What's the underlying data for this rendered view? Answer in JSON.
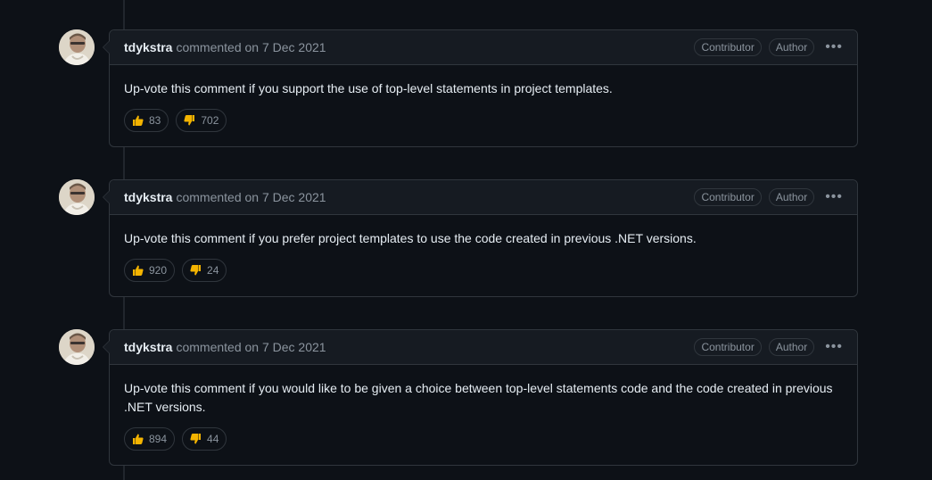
{
  "colors": {
    "background": "#0d1117",
    "header_bg": "#161b22",
    "border": "#30363d",
    "muted_text": "#8b949e",
    "text": "#e6edf3",
    "emoji_yellow": "#f4b400"
  },
  "comments": [
    {
      "author": "tdykstra",
      "meta": "commented on 7 Dec 2021",
      "labels": [
        "Contributor",
        "Author"
      ],
      "more_icon": "kebab-horizontal-icon",
      "body": "Up-vote this comment if you support the use of top-level statements in project templates.",
      "reactions": [
        {
          "icon": "thumbs-up-icon",
          "count": "83"
        },
        {
          "icon": "thumbs-down-icon",
          "count": "702"
        }
      ]
    },
    {
      "author": "tdykstra",
      "meta": "commented on 7 Dec 2021",
      "labels": [
        "Contributor",
        "Author"
      ],
      "more_icon": "kebab-horizontal-icon",
      "body": "Up-vote this comment if you prefer project templates to use the code created in previous .NET versions.",
      "reactions": [
        {
          "icon": "thumbs-up-icon",
          "count": "920"
        },
        {
          "icon": "thumbs-down-icon",
          "count": "24"
        }
      ]
    },
    {
      "author": "tdykstra",
      "meta": "commented on 7 Dec 2021",
      "labels": [
        "Contributor",
        "Author"
      ],
      "more_icon": "kebab-horizontal-icon",
      "body": "Up-vote this comment if you would like to be given a choice between top-level statements code and the code created in previous .NET versions.",
      "reactions": [
        {
          "icon": "thumbs-up-icon",
          "count": "894"
        },
        {
          "icon": "thumbs-down-icon",
          "count": "44"
        }
      ]
    }
  ]
}
